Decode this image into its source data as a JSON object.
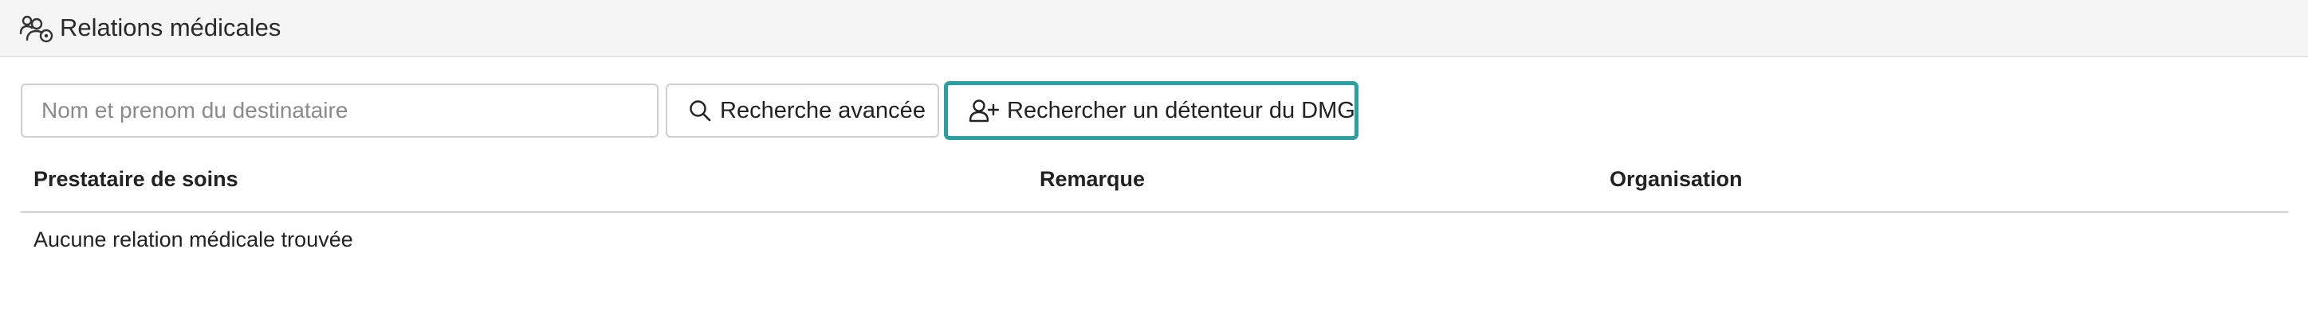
{
  "header": {
    "title": "Relations médicales",
    "icon": "users-settings-icon"
  },
  "search": {
    "placeholder": "Nom et prenom du destinataire",
    "value": ""
  },
  "buttons": {
    "advanced_search": {
      "label": "Recherche avancée",
      "icon": "search-icon"
    },
    "dmg_search": {
      "label": "Rechercher un détenteur du DMG",
      "icon": "user-plus-icon",
      "focus_color": "#2aa0a4"
    }
  },
  "table": {
    "columns": [
      "Prestataire de soins",
      "Remarque",
      "Organisation"
    ],
    "empty_message": "Aucune relation médicale trouvée"
  }
}
